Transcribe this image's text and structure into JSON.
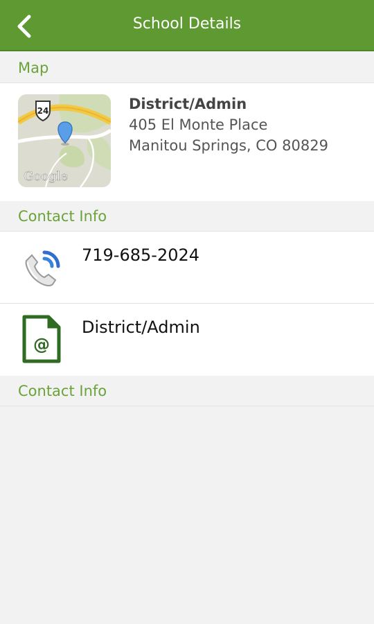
{
  "nav": {
    "title": "School Details",
    "back_icon": "chevron-left-icon"
  },
  "sections": {
    "map": "Map",
    "contact1": "Contact Info",
    "contact2": "Contact Info"
  },
  "map_card": {
    "name": "District/Admin",
    "address_line1": "405 El Monte Place",
    "address_line2": "Manitou Springs, CO 80829",
    "map_shield": "24",
    "map_brand": "Google"
  },
  "contacts": {
    "phone": {
      "icon": "phone-icon",
      "value": "719-685-2024"
    },
    "email": {
      "icon": "email-document-icon",
      "value": "District/Admin"
    }
  },
  "colors": {
    "accent": "#5e9a31",
    "section_text": "#6aa33a"
  }
}
